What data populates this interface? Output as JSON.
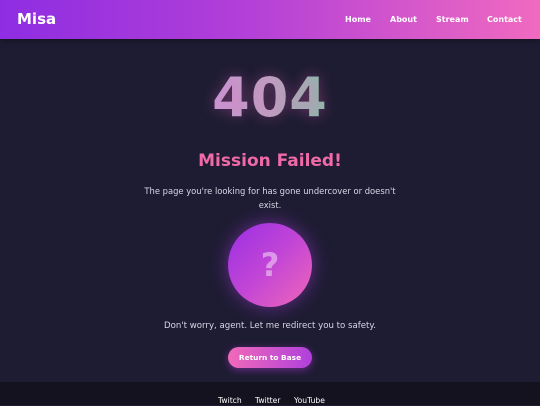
{
  "header": {
    "logo": "Misa",
    "nav": [
      "Home",
      "About",
      "Stream",
      "Contact"
    ]
  },
  "error": {
    "code": "404",
    "title": "Mission Failed!",
    "description": "The page you're looking for has gone undercover or doesn't exist.",
    "icon": "?",
    "icon_name": "question-mark-icon",
    "reassurance": "Don't worry, agent. Let me redirect you to safety.",
    "button_label": "Return to Base"
  },
  "footer": {
    "links": [
      "Twitch",
      "Twitter",
      "YouTube"
    ]
  },
  "colors": {
    "header_gradient_start": "#8e2de2",
    "header_gradient_end": "#f06ac0",
    "background": "#1e1c33",
    "accent_pink": "#f06aa8",
    "footer_background": "#14121f"
  }
}
